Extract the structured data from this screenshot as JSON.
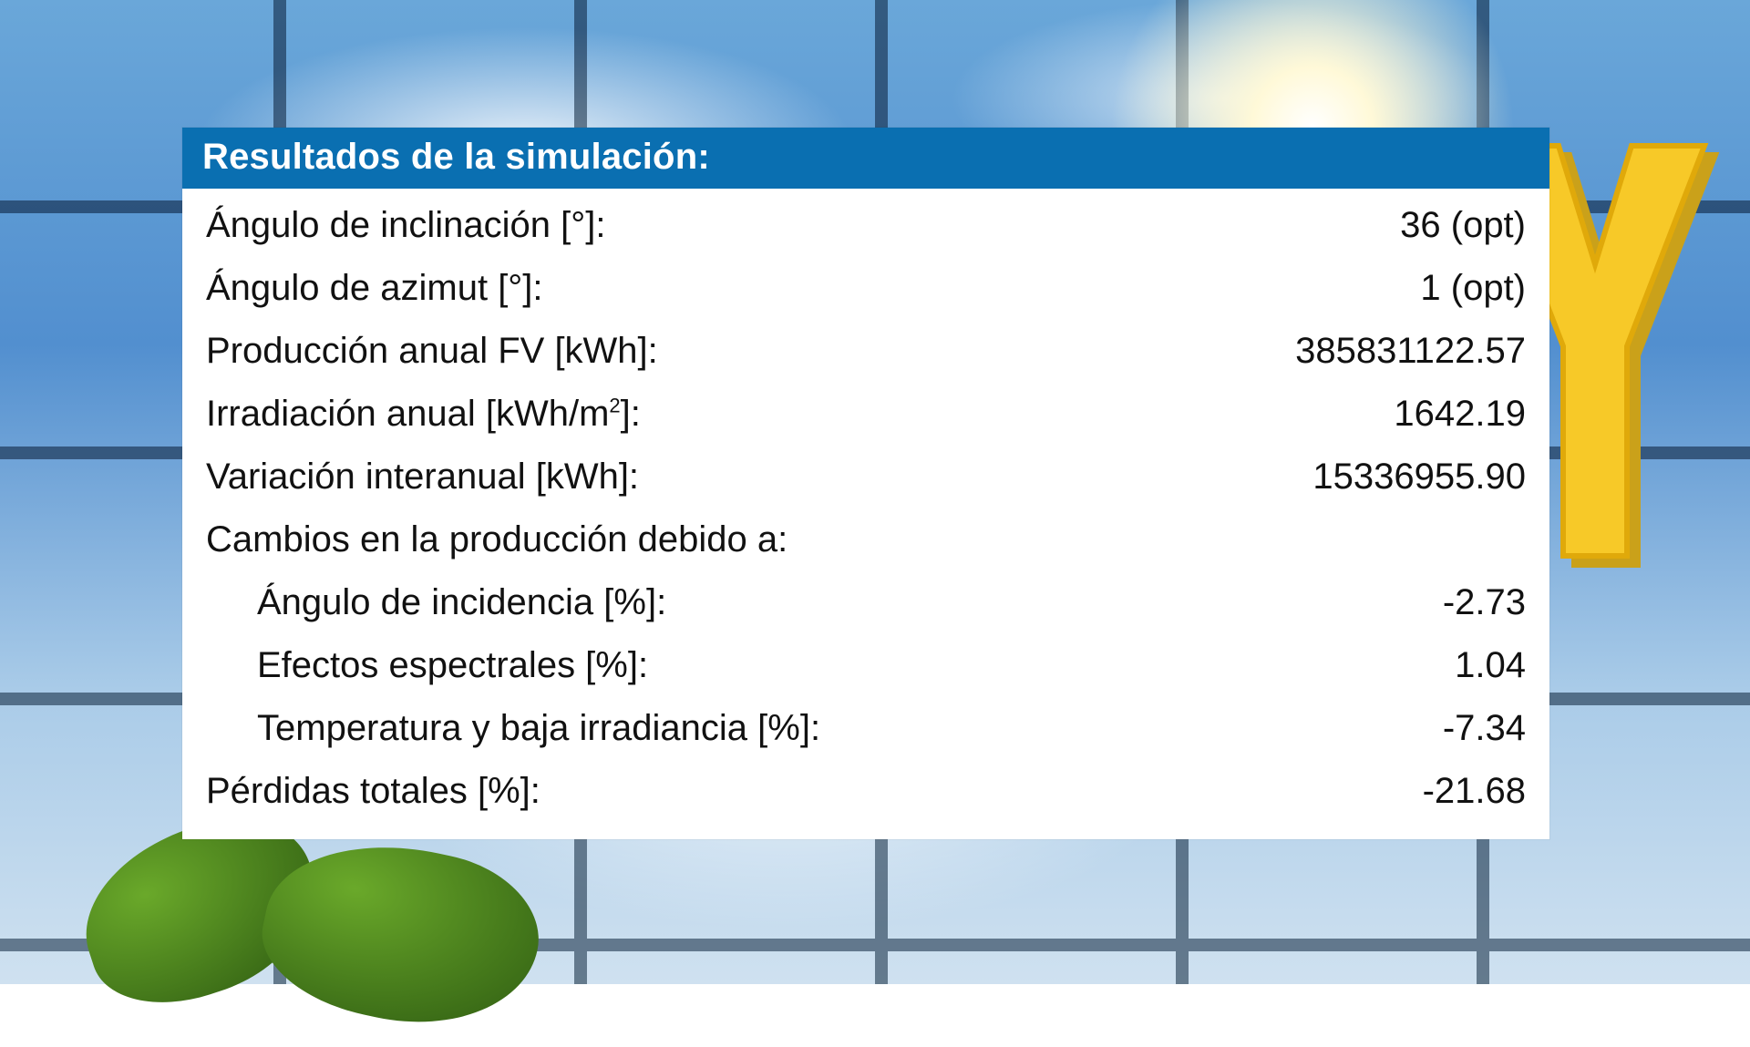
{
  "header": {
    "title": "Resultados de la simulación:"
  },
  "rows": {
    "tilt": {
      "label": "Ángulo de inclinación [°]:",
      "value": "36 (opt)"
    },
    "azimuth": {
      "label": "Ángulo de azimut [°]:",
      "value": "1 (opt)"
    },
    "annual_pv": {
      "label": "Producción anual FV [kWh]:",
      "value": "385831122.57"
    },
    "irradiation": {
      "label_html": "Irradiación anual [kWh/m²]:",
      "label": "Irradiación anual [kWh/m2]:",
      "value": "1642.19"
    },
    "interannual": {
      "label": "Variación interanual [kWh]:",
      "value": "15336955.90"
    },
    "changes_hdr": {
      "label": "Cambios en la producción debido a:"
    },
    "aoi": {
      "label": "Ángulo de incidencia [%]:",
      "value": "-2.73"
    },
    "spectral": {
      "label": "Efectos espectrales [%]:",
      "value": "1.04"
    },
    "temp": {
      "label": "Temperatura y baja irradiancia [%]:",
      "value": "-7.34"
    },
    "total_loss": {
      "label": "Pérdidas totales [%]:",
      "value": "-21.68"
    }
  }
}
